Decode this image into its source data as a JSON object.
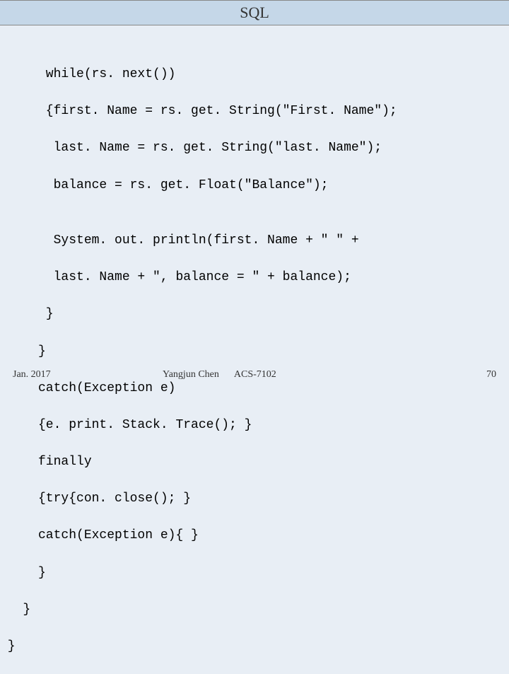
{
  "header": {
    "title": "SQL"
  },
  "code": {
    "l1": "      while(rs. next())",
    "l2": "      {first. Name = rs. get. String(\"First. Name\");",
    "l3": "       last. Name = rs. get. String(\"last. Name\");",
    "l4": "       balance = rs. get. Float(\"Balance\");",
    "l5": "",
    "l6": "       System. out. println(first. Name + \" \" +",
    "l7": "       last. Name + \", balance = \" + balance);",
    "l8": "      }",
    "l9": "     }",
    "l10": "     catch(Exception e)",
    "l11": "     {e. print. Stack. Trace(); }",
    "l12": "     finally",
    "l13": "     {try{con. close(); }",
    "l14": "     catch(Exception e){ }",
    "l15": "     }",
    "l16": "   }",
    "l17": " }"
  },
  "footer": {
    "date": "Jan. 2017",
    "author": "Yangjun Chen",
    "course": "ACS-7102",
    "page": "70"
  }
}
